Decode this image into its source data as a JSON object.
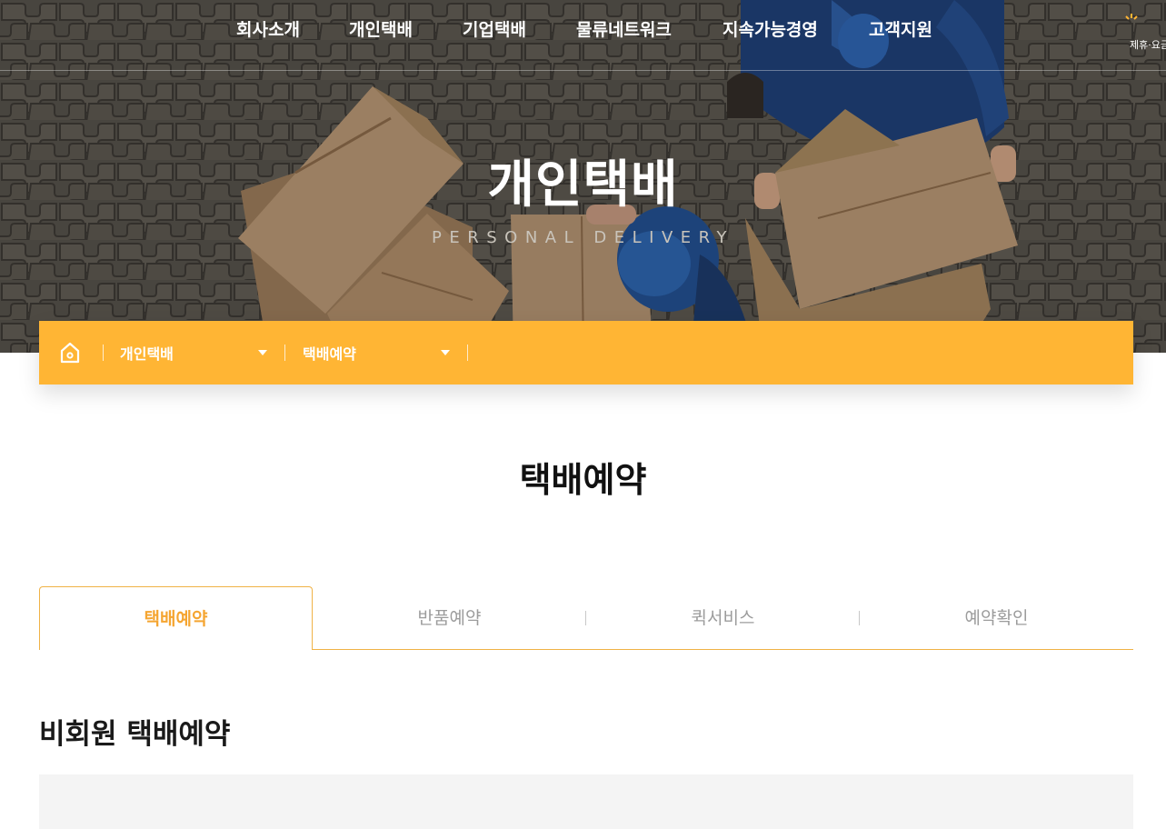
{
  "colors": {
    "accent": "#ffb534",
    "tab_active_text": "#f5a531",
    "tab_border": "#f0b246",
    "tab_inactive_text": "#9c9c9c",
    "form_bg": "#f4f4f4"
  },
  "header": {
    "nav": [
      "회사소개",
      "개인택배",
      "기업택배",
      "물류네트워크",
      "지속가능경영",
      "고객지원"
    ],
    "right_link": "제휴·요금",
    "right_icon": "sparkle-icon"
  },
  "hero": {
    "title": "개인택배",
    "subtitle": "PERSONAL DELIVERY"
  },
  "location": {
    "home_icon": "home-icon",
    "depth1": "개인택배",
    "depth2": "택배예약"
  },
  "main": {
    "page_title": "택배예약",
    "tabs": [
      {
        "label": "택배예약",
        "active": true
      },
      {
        "label": "반품예약",
        "active": false
      },
      {
        "label": "퀵서비스",
        "active": false
      },
      {
        "label": "예약확인",
        "active": false
      }
    ],
    "section_title": "비회원 택배예약"
  }
}
